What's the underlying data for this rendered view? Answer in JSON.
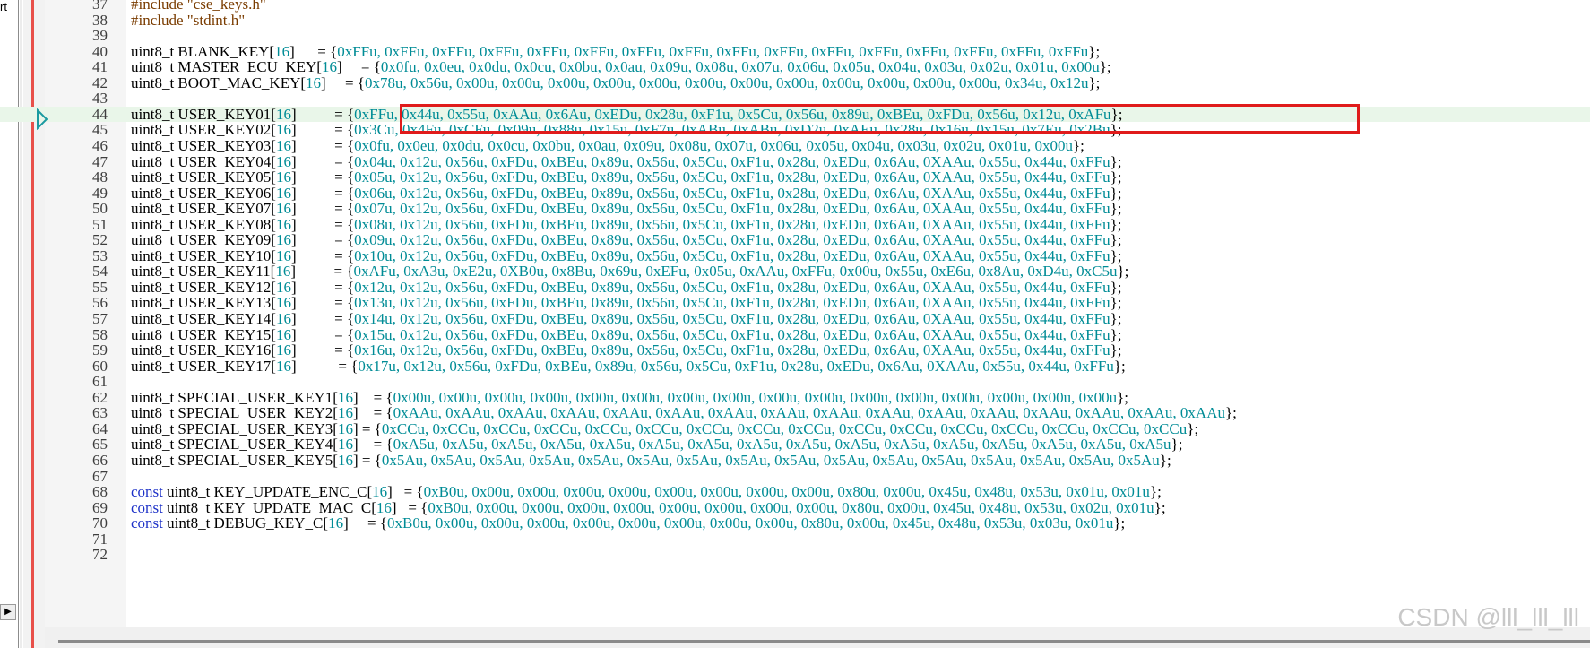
{
  "sidebar": {
    "stub_text": "rt",
    "scroll_right_glyph": "▶"
  },
  "colors": {
    "keyword": "#1e32c8",
    "number": "#008c96",
    "preprocessor": "#7a3c00",
    "current_line": "#e9f6e9",
    "highlight_box": "#e01b1b",
    "breakpoint_bar": "#e8504a"
  },
  "current_line": 44,
  "lines": [
    {
      "n": "37",
      "segments": [
        {
          "t": "#include \"cse_keys.h\"",
          "c": "pre"
        }
      ]
    },
    {
      "n": "38",
      "segments": [
        {
          "t": "#include \"stdint.h\"",
          "c": "pre"
        }
      ]
    },
    {
      "n": "39",
      "segments": []
    },
    {
      "n": "40",
      "segments": [
        {
          "t": "uint8_t BLANK_KEY[",
          "c": "plain"
        },
        {
          "t": "16",
          "c": "num"
        },
        {
          "t": "]      = {",
          "c": "plain"
        },
        {
          "t": "0xFFu, 0xFFu, 0xFFu, 0xFFu, 0xFFu, 0xFFu, 0xFFu, 0xFFu, 0xFFu, 0xFFu, 0xFFu, 0xFFu, 0xFFu, 0xFFu, 0xFFu, 0xFFu",
          "c": "num"
        },
        {
          "t": "};",
          "c": "plain"
        }
      ]
    },
    {
      "n": "41",
      "segments": [
        {
          "t": "uint8_t MASTER_ECU_KEY[",
          "c": "plain"
        },
        {
          "t": "16",
          "c": "num"
        },
        {
          "t": "]     = {",
          "c": "plain"
        },
        {
          "t": "0x0fu, 0x0eu, 0x0du, 0x0cu, 0x0bu, 0x0au, 0x09u, 0x08u, 0x07u, 0x06u, 0x05u, 0x04u, 0x03u, 0x02u, 0x01u, 0x00u",
          "c": "num"
        },
        {
          "t": "};",
          "c": "plain"
        }
      ]
    },
    {
      "n": "42",
      "segments": [
        {
          "t": "uint8_t BOOT_MAC_KEY[",
          "c": "plain"
        },
        {
          "t": "16",
          "c": "num"
        },
        {
          "t": "]     = {",
          "c": "plain"
        },
        {
          "t": "0x78u, 0x56u, 0x00u, 0x00u, 0x00u, 0x00u, 0x00u, 0x00u, 0x00u, 0x00u, 0x00u, 0x00u, 0x00u, 0x00u, 0x34u, 0x12u",
          "c": "num"
        },
        {
          "t": "};",
          "c": "plain"
        }
      ]
    },
    {
      "n": "43",
      "segments": []
    },
    {
      "n": "44",
      "segments": [
        {
          "t": "uint8_t USER_KEY01[",
          "c": "plain"
        },
        {
          "t": "16",
          "c": "num"
        },
        {
          "t": "]          = {",
          "c": "plain"
        },
        {
          "t": "0xFFu, 0x44u, 0x55u, 0xAAu, 0x6Au, 0xEDu, 0x28u, 0xF1u, 0x5Cu, 0x56u, 0x89u, 0xBEu, 0xFDu, 0x56u, 0x12u, 0xAFu",
          "c": "num"
        },
        {
          "t": "};",
          "c": "plain"
        }
      ]
    },
    {
      "n": "45",
      "segments": [
        {
          "t": "uint8_t USER_KEY02[",
          "c": "plain"
        },
        {
          "t": "16",
          "c": "num"
        },
        {
          "t": "]          = {",
          "c": "plain"
        },
        {
          "t": "0x3Cu, 0x4Fu, 0xCFu, 0x09u, 0x88u, 0x15u, 0xF7u, 0xABu, 0xABu, 0xD2u, 0xAEu, 0x28u, 0x16u, 0x15u, 0x7Eu, 0x2Bu",
          "c": "num"
        },
        {
          "t": "};",
          "c": "plain"
        }
      ]
    },
    {
      "n": "46",
      "segments": [
        {
          "t": "uint8_t USER_KEY03[",
          "c": "plain"
        },
        {
          "t": "16",
          "c": "num"
        },
        {
          "t": "]          = {",
          "c": "plain"
        },
        {
          "t": "0x0fu, 0x0eu, 0x0du, 0x0cu, 0x0bu, 0x0au, 0x09u, 0x08u, 0x07u, 0x06u, 0x05u, 0x04u, 0x03u, 0x02u, 0x01u, 0x00u",
          "c": "num"
        },
        {
          "t": "};",
          "c": "plain"
        }
      ]
    },
    {
      "n": "47",
      "segments": [
        {
          "t": "uint8_t USER_KEY04[",
          "c": "plain"
        },
        {
          "t": "16",
          "c": "num"
        },
        {
          "t": "]          = {",
          "c": "plain"
        },
        {
          "t": "0x04u, 0x12u, 0x56u, 0xFDu, 0xBEu, 0x89u, 0x56u, 0x5Cu, 0xF1u, 0x28u, 0xEDu, 0x6Au, 0XAAu, 0x55u, 0x44u, 0xFFu",
          "c": "num"
        },
        {
          "t": "};",
          "c": "plain"
        }
      ]
    },
    {
      "n": "48",
      "segments": [
        {
          "t": "uint8_t USER_KEY05[",
          "c": "plain"
        },
        {
          "t": "16",
          "c": "num"
        },
        {
          "t": "]          = {",
          "c": "plain"
        },
        {
          "t": "0x05u, 0x12u, 0x56u, 0xFDu, 0xBEu, 0x89u, 0x56u, 0x5Cu, 0xF1u, 0x28u, 0xEDu, 0x6Au, 0XAAu, 0x55u, 0x44u, 0xFFu",
          "c": "num"
        },
        {
          "t": "};",
          "c": "plain"
        }
      ]
    },
    {
      "n": "49",
      "segments": [
        {
          "t": "uint8_t USER_KEY06[",
          "c": "plain"
        },
        {
          "t": "16",
          "c": "num"
        },
        {
          "t": "]          = {",
          "c": "plain"
        },
        {
          "t": "0x06u, 0x12u, 0x56u, 0xFDu, 0xBEu, 0x89u, 0x56u, 0x5Cu, 0xF1u, 0x28u, 0xEDu, 0x6Au, 0XAAu, 0x55u, 0x44u, 0xFFu",
          "c": "num"
        },
        {
          "t": "};",
          "c": "plain"
        }
      ]
    },
    {
      "n": "50",
      "segments": [
        {
          "t": "uint8_t USER_KEY07[",
          "c": "plain"
        },
        {
          "t": "16",
          "c": "num"
        },
        {
          "t": "]          = {",
          "c": "plain"
        },
        {
          "t": "0x07u, 0x12u, 0x56u, 0xFDu, 0xBEu, 0x89u, 0x56u, 0x5Cu, 0xF1u, 0x28u, 0xEDu, 0x6Au, 0XAAu, 0x55u, 0x44u, 0xFFu",
          "c": "num"
        },
        {
          "t": "};",
          "c": "plain"
        }
      ]
    },
    {
      "n": "51",
      "segments": [
        {
          "t": "uint8_t USER_KEY08[",
          "c": "plain"
        },
        {
          "t": "16",
          "c": "num"
        },
        {
          "t": "]          = {",
          "c": "plain"
        },
        {
          "t": "0x08u, 0x12u, 0x56u, 0xFDu, 0xBEu, 0x89u, 0x56u, 0x5Cu, 0xF1u, 0x28u, 0xEDu, 0x6Au, 0XAAu, 0x55u, 0x44u, 0xFFu",
          "c": "num"
        },
        {
          "t": "};",
          "c": "plain"
        }
      ]
    },
    {
      "n": "52",
      "segments": [
        {
          "t": "uint8_t USER_KEY09[",
          "c": "plain"
        },
        {
          "t": "16",
          "c": "num"
        },
        {
          "t": "]          = {",
          "c": "plain"
        },
        {
          "t": "0x09u, 0x12u, 0x56u, 0xFDu, 0xBEu, 0x89u, 0x56u, 0x5Cu, 0xF1u, 0x28u, 0xEDu, 0x6Au, 0XAAu, 0x55u, 0x44u, 0xFFu",
          "c": "num"
        },
        {
          "t": "};",
          "c": "plain"
        }
      ]
    },
    {
      "n": "53",
      "segments": [
        {
          "t": "uint8_t USER_KEY10[",
          "c": "plain"
        },
        {
          "t": "16",
          "c": "num"
        },
        {
          "t": "]          = {",
          "c": "plain"
        },
        {
          "t": "0x10u, 0x12u, 0x56u, 0xFDu, 0xBEu, 0x89u, 0x56u, 0x5Cu, 0xF1u, 0x28u, 0xEDu, 0x6Au, 0XAAu, 0x55u, 0x44u, 0xFFu",
          "c": "num"
        },
        {
          "t": "};",
          "c": "plain"
        }
      ]
    },
    {
      "n": "54",
      "segments": [
        {
          "t": "uint8_t USER_KEY11[",
          "c": "plain"
        },
        {
          "t": "16",
          "c": "num"
        },
        {
          "t": "]          = {",
          "c": "plain"
        },
        {
          "t": "0xAFu, 0xA3u, 0xE2u, 0XB0u, 0x8Bu, 0x69u, 0xEFu, 0x05u, 0xAAu, 0xFFu, 0x00u, 0x55u, 0xE6u, 0x8Au, 0xD4u, 0xC5u",
          "c": "num"
        },
        {
          "t": "};",
          "c": "plain"
        }
      ]
    },
    {
      "n": "55",
      "segments": [
        {
          "t": "uint8_t USER_KEY12[",
          "c": "plain"
        },
        {
          "t": "16",
          "c": "num"
        },
        {
          "t": "]          = {",
          "c": "plain"
        },
        {
          "t": "0x12u, 0x12u, 0x56u, 0xFDu, 0xBEu, 0x89u, 0x56u, 0x5Cu, 0xF1u, 0x28u, 0xEDu, 0x6Au, 0XAAu, 0x55u, 0x44u, 0xFFu",
          "c": "num"
        },
        {
          "t": "};",
          "c": "plain"
        }
      ]
    },
    {
      "n": "56",
      "segments": [
        {
          "t": "uint8_t USER_KEY13[",
          "c": "plain"
        },
        {
          "t": "16",
          "c": "num"
        },
        {
          "t": "]          = {",
          "c": "plain"
        },
        {
          "t": "0x13u, 0x12u, 0x56u, 0xFDu, 0xBEu, 0x89u, 0x56u, 0x5Cu, 0xF1u, 0x28u, 0xEDu, 0x6Au, 0XAAu, 0x55u, 0x44u, 0xFFu",
          "c": "num"
        },
        {
          "t": "};",
          "c": "plain"
        }
      ]
    },
    {
      "n": "57",
      "segments": [
        {
          "t": "uint8_t USER_KEY14[",
          "c": "plain"
        },
        {
          "t": "16",
          "c": "num"
        },
        {
          "t": "]          = {",
          "c": "plain"
        },
        {
          "t": "0x14u, 0x12u, 0x56u, 0xFDu, 0xBEu, 0x89u, 0x56u, 0x5Cu, 0xF1u, 0x28u, 0xEDu, 0x6Au, 0XAAu, 0x55u, 0x44u, 0xFFu",
          "c": "num"
        },
        {
          "t": "};",
          "c": "plain"
        }
      ]
    },
    {
      "n": "58",
      "segments": [
        {
          "t": "uint8_t USER_KEY15[",
          "c": "plain"
        },
        {
          "t": "16",
          "c": "num"
        },
        {
          "t": "]          = {",
          "c": "plain"
        },
        {
          "t": "0x15u, 0x12u, 0x56u, 0xFDu, 0xBEu, 0x89u, 0x56u, 0x5Cu, 0xF1u, 0x28u, 0xEDu, 0x6Au, 0XAAu, 0x55u, 0x44u, 0xFFu",
          "c": "num"
        },
        {
          "t": "};",
          "c": "plain"
        }
      ]
    },
    {
      "n": "59",
      "segments": [
        {
          "t": "uint8_t USER_KEY16[",
          "c": "plain"
        },
        {
          "t": "16",
          "c": "num"
        },
        {
          "t": "]          = {",
          "c": "plain"
        },
        {
          "t": "0x16u, 0x12u, 0x56u, 0xFDu, 0xBEu, 0x89u, 0x56u, 0x5Cu, 0xF1u, 0x28u, 0xEDu, 0x6Au, 0XAAu, 0x55u, 0x44u, 0xFFu",
          "c": "num"
        },
        {
          "t": "};",
          "c": "plain"
        }
      ]
    },
    {
      "n": "60",
      "segments": [
        {
          "t": "uint8_t USER_KEY17[",
          "c": "plain"
        },
        {
          "t": "16",
          "c": "num"
        },
        {
          "t": "]           = {",
          "c": "plain"
        },
        {
          "t": "0x17u, 0x12u, 0x56u, 0xFDu, 0xBEu, 0x89u, 0x56u, 0x5Cu, 0xF1u, 0x28u, 0xEDu, 0x6Au, 0XAAu, 0x55u, 0x44u, 0xFFu",
          "c": "num"
        },
        {
          "t": "};",
          "c": "plain"
        }
      ]
    },
    {
      "n": "61",
      "segments": []
    },
    {
      "n": "62",
      "segments": [
        {
          "t": "uint8_t SPECIAL_USER_KEY1[",
          "c": "plain"
        },
        {
          "t": "16",
          "c": "num"
        },
        {
          "t": "]    = {",
          "c": "plain"
        },
        {
          "t": "0x00u, 0x00u, 0x00u, 0x00u, 0x00u, 0x00u, 0x00u, 0x00u, 0x00u, 0x00u, 0x00u, 0x00u, 0x00u, 0x00u, 0x00u, 0x00u",
          "c": "num"
        },
        {
          "t": "};",
          "c": "plain"
        }
      ]
    },
    {
      "n": "63",
      "segments": [
        {
          "t": "uint8_t SPECIAL_USER_KEY2[",
          "c": "plain"
        },
        {
          "t": "16",
          "c": "num"
        },
        {
          "t": "]    = {",
          "c": "plain"
        },
        {
          "t": "0xAAu, 0xAAu, 0xAAu, 0xAAu, 0xAAu, 0xAAu, 0xAAu, 0xAAu, 0xAAu, 0xAAu, 0xAAu, 0xAAu, 0xAAu, 0xAAu, 0xAAu, 0xAAu",
          "c": "num"
        },
        {
          "t": "};",
          "c": "plain"
        }
      ]
    },
    {
      "n": "64",
      "segments": [
        {
          "t": "uint8_t SPECIAL_USER_KEY3[",
          "c": "plain"
        },
        {
          "t": "16",
          "c": "num"
        },
        {
          "t": "] = {",
          "c": "plain"
        },
        {
          "t": "0xCCu, 0xCCu, 0xCCu, 0xCCu, 0xCCu, 0xCCu, 0xCCu, 0xCCu, 0xCCu, 0xCCu, 0xCCu, 0xCCu, 0xCCu, 0xCCu, 0xCCu, 0xCCu",
          "c": "num"
        },
        {
          "t": "};",
          "c": "plain"
        }
      ]
    },
    {
      "n": "65",
      "segments": [
        {
          "t": "uint8_t SPECIAL_USER_KEY4[",
          "c": "plain"
        },
        {
          "t": "16",
          "c": "num"
        },
        {
          "t": "]    = {",
          "c": "plain"
        },
        {
          "t": "0xA5u, 0xA5u, 0xA5u, 0xA5u, 0xA5u, 0xA5u, 0xA5u, 0xA5u, 0xA5u, 0xA5u, 0xA5u, 0xA5u, 0xA5u, 0xA5u, 0xA5u, 0xA5u",
          "c": "num"
        },
        {
          "t": "};",
          "c": "plain"
        }
      ]
    },
    {
      "n": "66",
      "segments": [
        {
          "t": "uint8_t SPECIAL_USER_KEY5[",
          "c": "plain"
        },
        {
          "t": "16",
          "c": "num"
        },
        {
          "t": "] = {",
          "c": "plain"
        },
        {
          "t": "0x5Au, 0x5Au, 0x5Au, 0x5Au, 0x5Au, 0x5Au, 0x5Au, 0x5Au, 0x5Au, 0x5Au, 0x5Au, 0x5Au, 0x5Au, 0x5Au, 0x5Au, 0x5Au",
          "c": "num"
        },
        {
          "t": "};",
          "c": "plain"
        }
      ]
    },
    {
      "n": "67",
      "segments": []
    },
    {
      "n": "68",
      "segments": [
        {
          "t": "const",
          "c": "kw"
        },
        {
          "t": " uint8_t KEY_UPDATE_ENC_C[",
          "c": "plain"
        },
        {
          "t": "16",
          "c": "num"
        },
        {
          "t": "]   = {",
          "c": "plain"
        },
        {
          "t": "0xB0u, 0x00u, 0x00u, 0x00u, 0x00u, 0x00u, 0x00u, 0x00u, 0x00u, 0x80u, 0x00u, 0x45u, 0x48u, 0x53u, 0x01u, 0x01u",
          "c": "num"
        },
        {
          "t": "};",
          "c": "plain"
        }
      ]
    },
    {
      "n": "69",
      "segments": [
        {
          "t": "const",
          "c": "kw"
        },
        {
          "t": " uint8_t KEY_UPDATE_MAC_C[",
          "c": "plain"
        },
        {
          "t": "16",
          "c": "num"
        },
        {
          "t": "]   = {",
          "c": "plain"
        },
        {
          "t": "0xB0u, 0x00u, 0x00u, 0x00u, 0x00u, 0x00u, 0x00u, 0x00u, 0x00u, 0x80u, 0x00u, 0x45u, 0x48u, 0x53u, 0x02u, 0x01u",
          "c": "num"
        },
        {
          "t": "};",
          "c": "plain"
        }
      ]
    },
    {
      "n": "70",
      "segments": [
        {
          "t": "const",
          "c": "kw"
        },
        {
          "t": " uint8_t DEBUG_KEY_C[",
          "c": "plain"
        },
        {
          "t": "16",
          "c": "num"
        },
        {
          "t": "]     = {",
          "c": "plain"
        },
        {
          "t": "0xB0u, 0x00u, 0x00u, 0x00u, 0x00u, 0x00u, 0x00u, 0x00u, 0x00u, 0x80u, 0x00u, 0x45u, 0x48u, 0x53u, 0x03u, 0x01u",
          "c": "num"
        },
        {
          "t": "};",
          "c": "plain"
        }
      ]
    },
    {
      "n": "71",
      "segments": []
    },
    {
      "n": "72",
      "segments": []
    }
  ],
  "watermark": "CSDN @lll_lll_lll"
}
